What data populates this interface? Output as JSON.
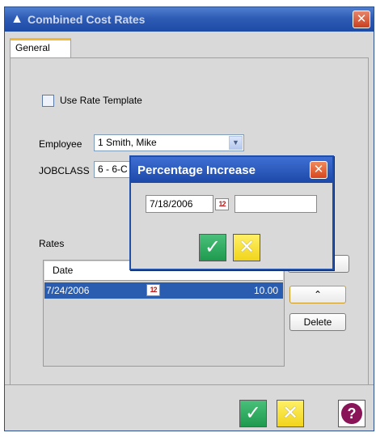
{
  "window": {
    "title": "Combined Cost Rates",
    "app_icon": "app-logo-icon",
    "close_icon": "close-icon"
  },
  "tabs": [
    {
      "label": "General",
      "active": true
    }
  ],
  "form": {
    "use_rate_template_label": "Use Rate Template",
    "use_rate_template_checked": false,
    "employee_label": "Employee",
    "employee_value": "1 Smith, Mike",
    "jobclass_label": "JOBCLASS",
    "jobclass_value": "6 - 6-C"
  },
  "rates": {
    "label": "Rates",
    "columns": [
      "Date"
    ],
    "rows": [
      {
        "date": "7/24/2006",
        "value": "10.00",
        "selected": true
      }
    ],
    "up_button_icon": "chevron-up-icon",
    "delete_label": "Delete"
  },
  "footer": {
    "ok_icon": "checkmark-icon",
    "cancel_icon": "x-cancel-icon",
    "help_icon": "help-icon"
  },
  "modal": {
    "title": "Percentage Increase",
    "date_value": "7/18/2006",
    "percent_value": "",
    "ok_icon": "checkmark-icon",
    "cancel_icon": "x-cancel-icon"
  },
  "colors": {
    "titlebar": "#2e5cb5",
    "selection": "#2a5cb0",
    "ok_green": "#1e9a4e",
    "cancel_yellow": "#f1d41a",
    "help_maroon": "#8a1458"
  }
}
